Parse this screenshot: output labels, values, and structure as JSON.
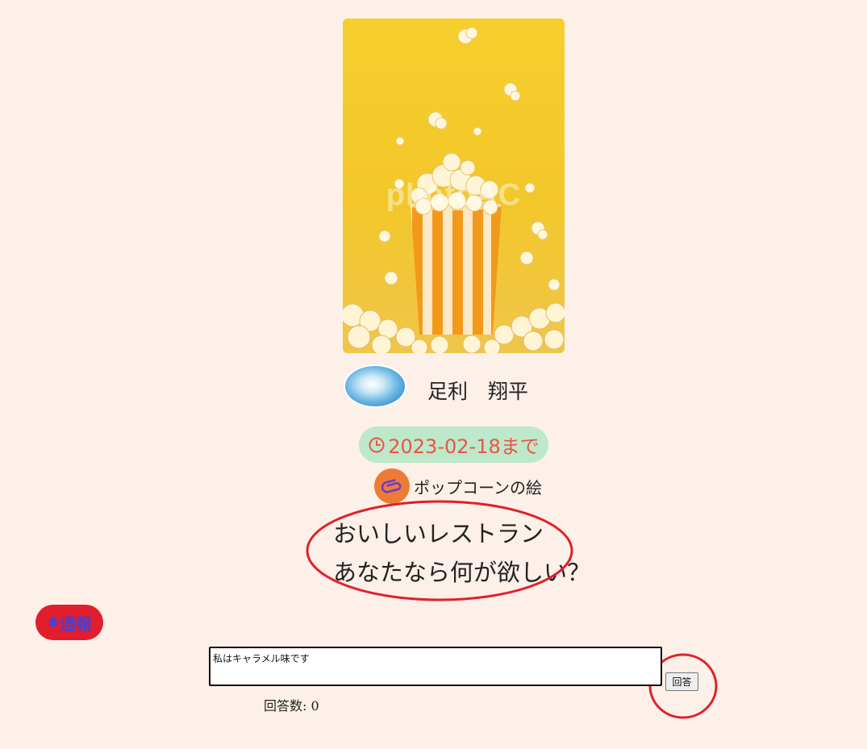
{
  "post": {
    "image": {
      "watermark": "photoAC",
      "alt": ""
    },
    "author": {
      "name": "足利　翔平"
    },
    "deadline": "2023-02-18まで",
    "attachment": {
      "label": "ポップコーンの絵"
    },
    "question": {
      "line1": "おいしいレストラン",
      "line2": "あなたなら何が欲しい？"
    }
  },
  "report_button": {
    "label": "通報"
  },
  "answer_form": {
    "input_value": "私はキャラメル味です",
    "submit_label": "回答",
    "count_text": "回答数: 0"
  },
  "colors": {
    "background": "#fdf0e8",
    "deadline_bg": "#bde8c9",
    "deadline_text": "#e8554a",
    "attach_circle": "#ec7c34",
    "report_bg": "#e21d2d",
    "report_text": "#4a3fd0",
    "annotation_circle": "#e0202a"
  },
  "icons": {
    "deadline": "clock-icon",
    "attachment": "paperclip-icon",
    "report": "bell-icon"
  }
}
